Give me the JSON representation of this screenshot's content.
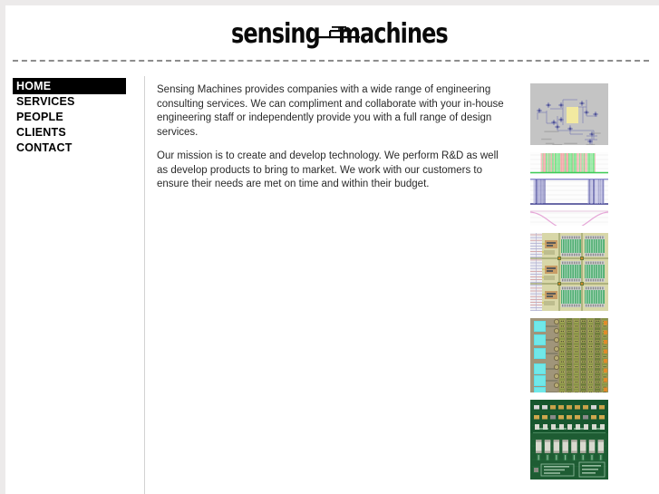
{
  "site": {
    "logo_word_1": "sensing",
    "logo_word_2": "machines",
    "logo_mark_name": "mems-bridge-icon"
  },
  "nav": {
    "items": [
      {
        "label": "HOME",
        "name": "nav-item-home",
        "active": true
      },
      {
        "label": "SERVICES",
        "name": "nav-item-services",
        "active": false
      },
      {
        "label": "PEOPLE",
        "name": "nav-item-people",
        "active": false
      },
      {
        "label": "CLIENTS",
        "name": "nav-item-clients",
        "active": false
      },
      {
        "label": "CONTACT",
        "name": "nav-item-contact",
        "active": false
      }
    ]
  },
  "content": {
    "paragraph_1": "Sensing Machines provides companies with a wide range of engineering consulting services. We can compliment and collaborate with your in-house engineering staff or independently provide you with a full range of design services.",
    "paragraph_2": "Our mission is to create and develop technology. We perform R&D as well as develop products to bring to market. We work with our customers to ensure their needs are met on time and within their budget."
  },
  "gallery": {
    "thumbnails": [
      {
        "name": "thumbnail-circuit-schematic",
        "kind": "schematic"
      },
      {
        "name": "thumbnail-waveform-plots",
        "kind": "waveforms"
      },
      {
        "name": "thumbnail-ic-layout",
        "kind": "layout"
      },
      {
        "name": "thumbnail-die-photo",
        "kind": "die"
      },
      {
        "name": "thumbnail-pcb-photo",
        "kind": "pcb"
      }
    ]
  },
  "colors": {
    "page_background": "#eceaea",
    "content_background": "#ffffff",
    "active_nav_background": "#000000",
    "active_nav_text": "#ffffff",
    "rule": "#8d8d8d",
    "body_text": "#2a2a2a"
  }
}
